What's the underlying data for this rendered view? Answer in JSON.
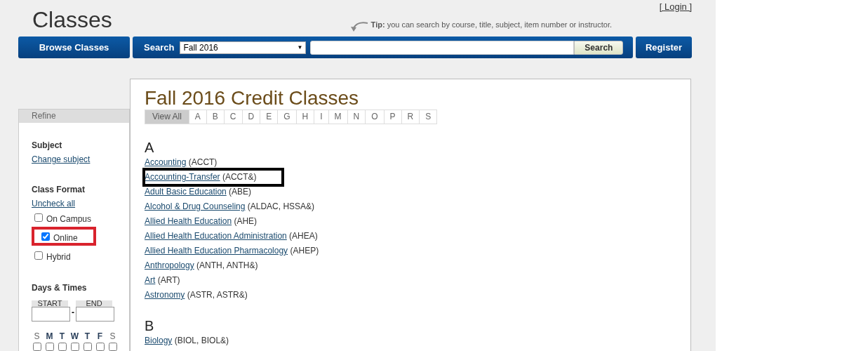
{
  "page": {
    "title": "Classes",
    "login_link": "[ Login ]"
  },
  "tip": {
    "label": "Tip:",
    "text": "you can search by course, title, subject, item number or instructor."
  },
  "nav": {
    "browse_button": "Browse Classes",
    "search_label": "Search",
    "term_select": "Fall 2016",
    "select_caret": "▼",
    "search_button": "Search",
    "register_button": "Register"
  },
  "sidebar": {
    "header": "Refine",
    "subject": {
      "heading": "Subject",
      "link": "Change subject"
    },
    "class_format": {
      "heading": "Class Format",
      "link": "Uncheck all",
      "options": [
        {
          "label": "On Campus",
          "checked": false,
          "highlighted": false
        },
        {
          "label": "Online",
          "checked": true,
          "highlighted": true
        },
        {
          "label": "Hybrid",
          "checked": false,
          "highlighted": false
        }
      ]
    },
    "days_times": {
      "heading": "Days & Times",
      "start_label": "START",
      "end_label": "END",
      "separator": "-",
      "days": [
        {
          "letter": "S",
          "bold": false,
          "checked": false
        },
        {
          "letter": "M",
          "bold": true,
          "checked": false
        },
        {
          "letter": "T",
          "bold": true,
          "checked": false
        },
        {
          "letter": "W",
          "bold": true,
          "checked": false
        },
        {
          "letter": "T",
          "bold": true,
          "checked": false
        },
        {
          "letter": "F",
          "bold": true,
          "checked": false
        },
        {
          "letter": "S",
          "bold": false,
          "checked": false
        }
      ]
    }
  },
  "main": {
    "title": "Fall 2016 Credit Classes",
    "letter_tabs": [
      {
        "label": "View All",
        "selected": true
      },
      {
        "label": "A",
        "selected": false
      },
      {
        "label": "B",
        "selected": false
      },
      {
        "label": "C",
        "selected": false
      },
      {
        "label": "D",
        "selected": false
      },
      {
        "label": "E",
        "selected": false
      },
      {
        "label": "G",
        "selected": false
      },
      {
        "label": "H",
        "selected": false
      },
      {
        "label": "I",
        "selected": false
      },
      {
        "label": "M",
        "selected": false
      },
      {
        "label": "N",
        "selected": false
      },
      {
        "label": "O",
        "selected": false
      },
      {
        "label": "P",
        "selected": false
      },
      {
        "label": "R",
        "selected": false
      },
      {
        "label": "S",
        "selected": false
      }
    ],
    "sections": [
      {
        "letter": "A",
        "subjects": [
          {
            "name": "Accounting",
            "codes": "(ACCT)",
            "highlighted": false
          },
          {
            "name": "Accounting-Transfer",
            "codes": "(ACCT&)",
            "highlighted": true
          },
          {
            "name": "Adult Basic Education",
            "codes": "(ABE)",
            "highlighted": false
          },
          {
            "name": "Alcohol & Drug Counseling",
            "codes": "(ALDAC, HSSA&)",
            "highlighted": false
          },
          {
            "name": "Allied Health Education",
            "codes": "(AHE)",
            "highlighted": false
          },
          {
            "name": "Allied Health Education Administration",
            "codes": "(AHEA)",
            "highlighted": false
          },
          {
            "name": "Allied Health Education Pharmacology",
            "codes": "(AHEP)",
            "highlighted": false
          },
          {
            "name": "Anthropology",
            "codes": "(ANTH, ANTH&)",
            "highlighted": false
          },
          {
            "name": "Art",
            "codes": "(ART)",
            "highlighted": false
          },
          {
            "name": "Astronomy",
            "codes": "(ASTR, ASTR&)",
            "highlighted": false
          }
        ]
      },
      {
        "letter": "B",
        "subjects": [
          {
            "name": "Biology",
            "codes": "(BIOL, BIOL&)",
            "highlighted": false
          }
        ]
      }
    ]
  }
}
